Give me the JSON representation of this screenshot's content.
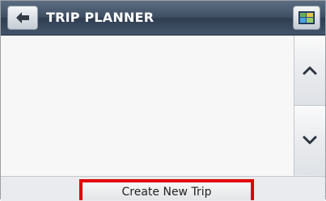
{
  "header": {
    "title": "TRIP PLANNER",
    "back_icon": "arrow-left-icon",
    "map_icon": "map-view-icon"
  },
  "scroll": {
    "up_icon": "chevron-up-icon",
    "down_icon": "chevron-down-icon"
  },
  "footer": {
    "create_label": "Create New Trip"
  },
  "colors": {
    "titlebar": "#3f4f63",
    "highlight": "#e00000",
    "background": "#f7f7f7"
  }
}
